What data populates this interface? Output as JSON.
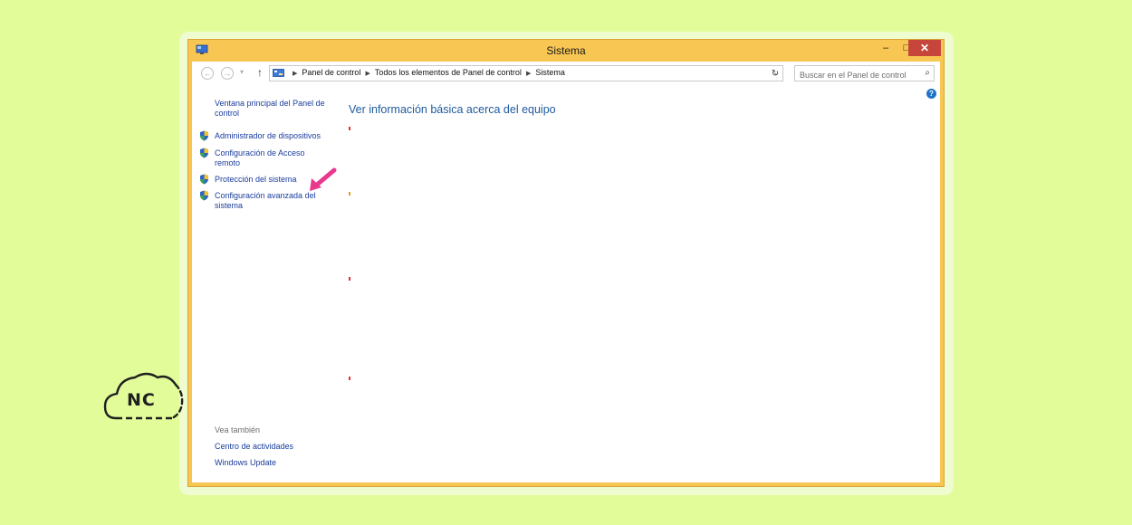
{
  "window": {
    "title": "Sistema",
    "minimize_label": "–",
    "maximize_label": "□",
    "close_label": "✕"
  },
  "addressbar": {
    "breadcrumbs": [
      "Panel de control",
      "Todos los elementos de Panel de control",
      "Sistema"
    ],
    "search_placeholder": "Buscar en el Panel de control"
  },
  "sidebar": {
    "home_link": "Ventana principal del Panel de control",
    "tasks": [
      {
        "label": "Administrador de dispositivos"
      },
      {
        "label": "Configuración de Acceso remoto"
      },
      {
        "label": "Protección del sistema"
      },
      {
        "label": "Configuración avanzada del sistema"
      }
    ],
    "see_also_header": "Vea también",
    "see_also": [
      "Centro de actividades",
      "Windows Update"
    ]
  },
  "main": {
    "title": "Ver información básica acerca del equipo"
  },
  "logo": {
    "text": "NC"
  },
  "colors": {
    "background": "#e2fc9a",
    "window_frame": "#f8c653",
    "close_button": "#c7463b",
    "link": "#1a3d9e",
    "heading": "#1e5a9c",
    "arrow": "#e8398e"
  }
}
